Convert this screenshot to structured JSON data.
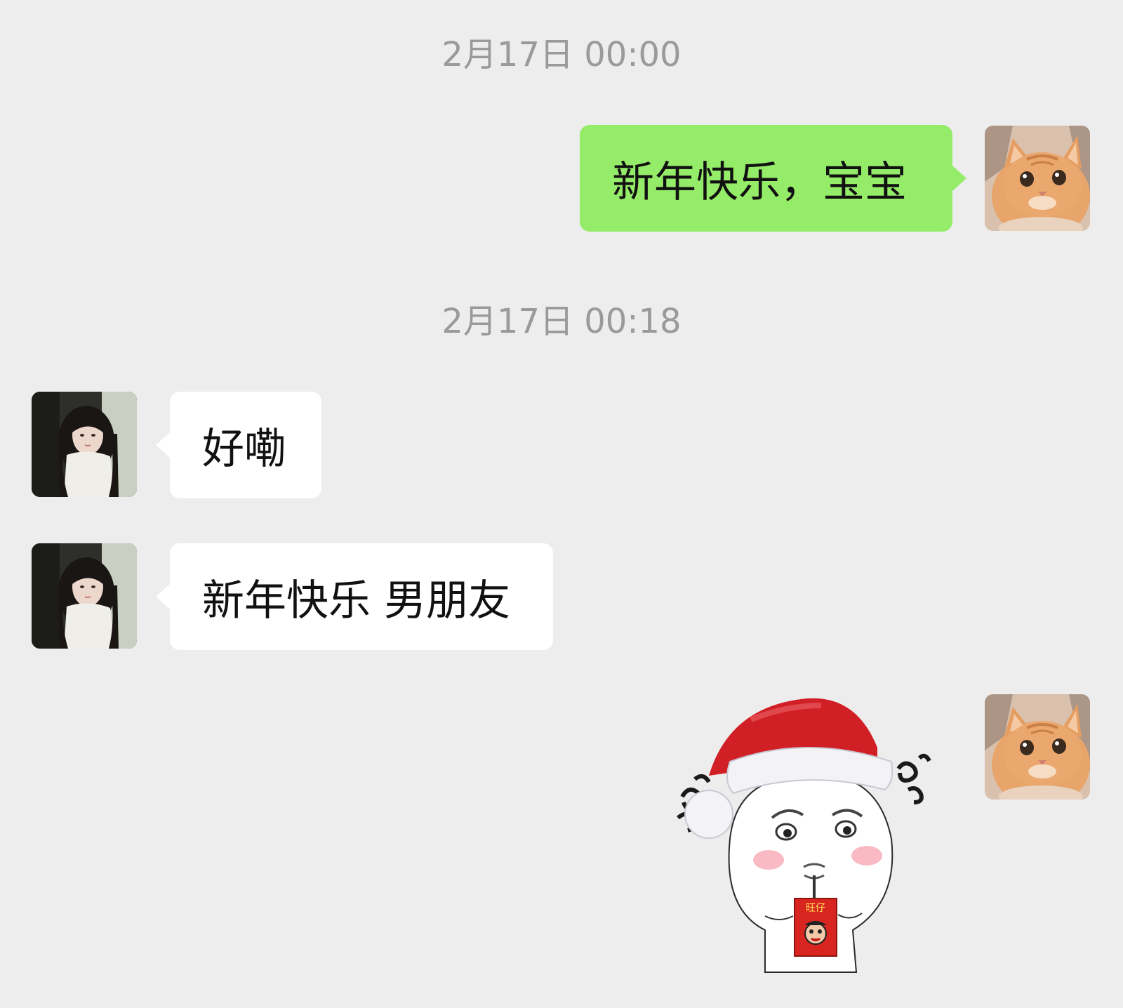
{
  "chat": {
    "timestamps": [
      "2月17日 00:00",
      "2月17日 00:18"
    ],
    "messages": [
      {
        "side": "out",
        "text": "新年快乐，宝宝"
      },
      {
        "side": "in",
        "text": "好嘞"
      },
      {
        "side": "in",
        "text": "新年快乐 男朋友"
      },
      {
        "side": "out",
        "sticker": "santa-hat-cartoon-sticker"
      }
    ]
  },
  "avatars": {
    "self": "orange-cat-icon",
    "contact": "girl-portrait-icon"
  },
  "sticker": {
    "packet_text": "旺仔"
  },
  "colors": {
    "background": "#ededed",
    "outgoing_bubble": "#95ec69",
    "incoming_bubble": "#ffffff",
    "timestamp": "#9a9a9a"
  }
}
